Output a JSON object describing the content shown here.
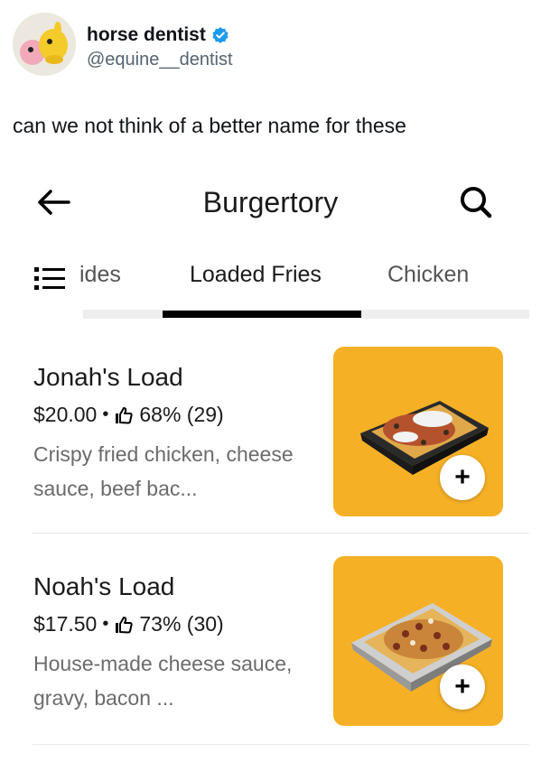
{
  "tweet": {
    "author_name": "horse dentist",
    "author_handle": "@equine__dentist",
    "text": "can we not think of a better name for these"
  },
  "app": {
    "title": "Burgertory",
    "tabs": [
      {
        "label": "ides",
        "active": false
      },
      {
        "label": "Loaded Fries",
        "active": true
      },
      {
        "label": "Chicken",
        "active": false
      }
    ],
    "items": [
      {
        "name": "Jonah's Load",
        "price": "$20.00",
        "rating": "68% (29)",
        "description": "Crispy fried chicken, cheese sauce, beef bac..."
      },
      {
        "name": "Noah's Load",
        "price": "$17.50",
        "rating": "73% (30)",
        "description": "House-made cheese sauce, gravy, bacon ..."
      }
    ],
    "add_label": "+"
  },
  "colors": {
    "photo_background": "#f6b026",
    "verified": "#1d9bf0"
  }
}
